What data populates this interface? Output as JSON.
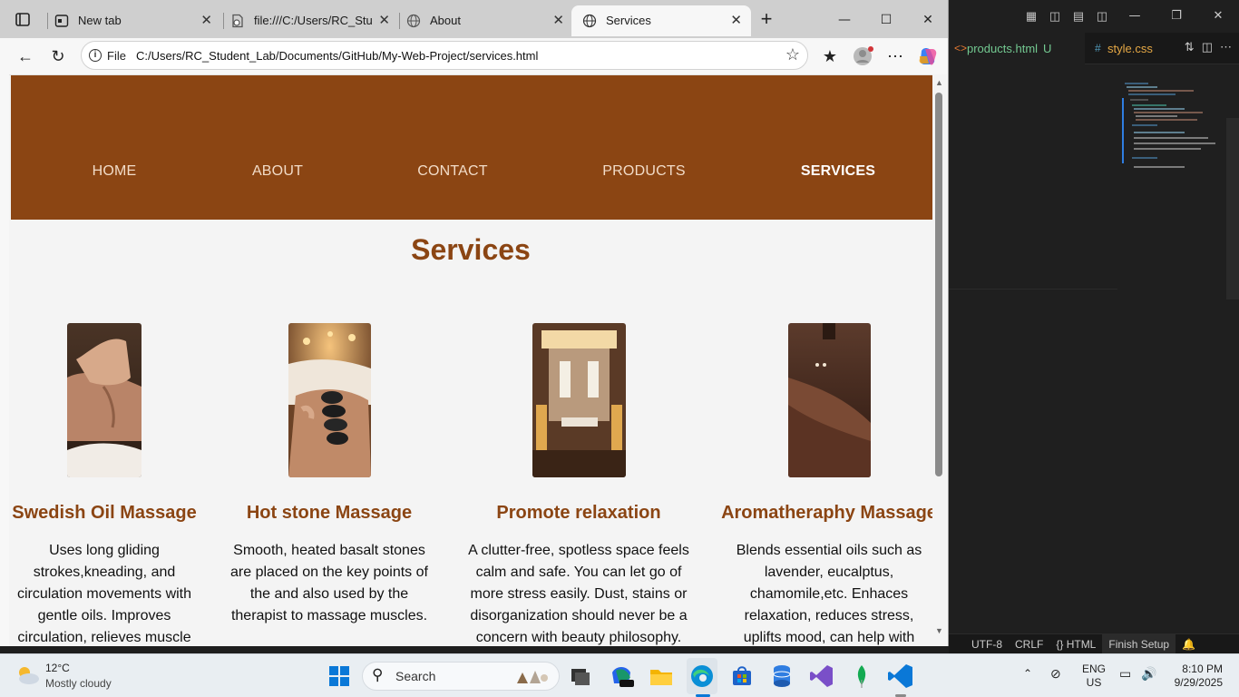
{
  "browser": {
    "tabs": [
      {
        "label": "New tab",
        "icon": "new-tab-icon"
      },
      {
        "label": "file:///C:/Users/RC_Student",
        "icon": "file-page-icon"
      },
      {
        "label": "About",
        "icon": "globe-icon"
      },
      {
        "label": "Services",
        "icon": "globe-icon"
      }
    ],
    "address": {
      "scheme": "File",
      "url": "C:/Users/RC_Student_Lab/Documents/GitHub/My-Web-Project/services.html"
    }
  },
  "page": {
    "nav": [
      "HOME",
      "ABOUT",
      "CONTACT",
      "PRODUCTS",
      "SERVICES"
    ],
    "current_nav": "SERVICES",
    "title": "Services",
    "colors": {
      "brand": "#8b4513",
      "background": "#f4f4f4"
    },
    "services": [
      {
        "title": "Swedish Oil Massage",
        "text": "Uses long gliding strokes,kneading, and circulation movements with gentle oils. Improves circulation, relieves muscle"
      },
      {
        "title": "Hot stone Massage",
        "text": "Smooth, heated basalt stones are placed on the key points of the and also used by the therapist to massage muscles."
      },
      {
        "title": "Promote relaxation",
        "text": "A clutter-free, spotless space feels calm and safe. You can let go of more stress easily. Dust, stains or disorganization should never be a concern with beauty philosophy."
      },
      {
        "title": "Aromatheraphy Massage",
        "text": "Blends essential oils such as lavender, eucalptus, chamomile,etc. Enhaces relaxation, reduces stress, uplifts mood, can help with"
      }
    ]
  },
  "vscode": {
    "tabs": [
      {
        "label": "products.html",
        "badge": "U"
      },
      {
        "label": "style.css"
      }
    ],
    "status": [
      "UTF-8",
      "CRLF",
      "{} HTML",
      "Finish Setup"
    ]
  },
  "taskbar": {
    "weather_temp": "12°C",
    "weather_cond": "Mostly cloudy",
    "search_placeholder": "Search",
    "lang_1": "ENG",
    "lang_2": "US",
    "time": "8:10 PM",
    "date": "9/29/2025"
  }
}
